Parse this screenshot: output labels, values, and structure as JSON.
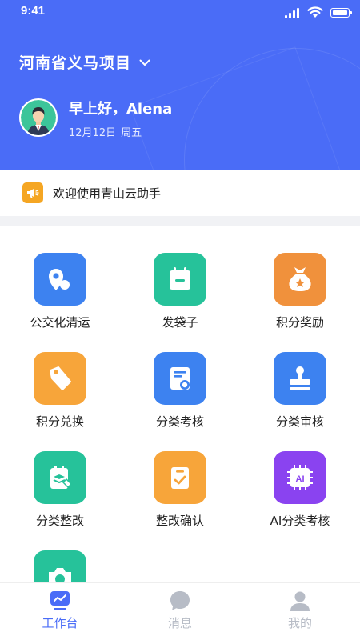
{
  "status_bar": {
    "time": "9:41"
  },
  "header": {
    "project_name": "河南省义马项目",
    "greeting": "早上好，Alena",
    "date": "12月12日",
    "weekday": "周五"
  },
  "notice": {
    "text": "欢迎使用青山云助手"
  },
  "colors": {
    "primary": "#4a6cf7",
    "tab_active": "#4a6cf7",
    "tab_inactive": "#b7bcc6"
  },
  "grid": {
    "items": [
      {
        "label": "公交化清运",
        "icon": "location-pin-icon",
        "color": "#3d82f0"
      },
      {
        "label": "发袋子",
        "icon": "bag-icon",
        "color": "#26c29a"
      },
      {
        "label": "积分奖励",
        "icon": "money-bag-icon",
        "color": "#f0913c"
      },
      {
        "label": "积分兑换",
        "icon": "tag-icon",
        "color": "#f7a53a"
      },
      {
        "label": "分类考核",
        "icon": "certificate-icon",
        "color": "#3d82f0"
      },
      {
        "label": "分类审核",
        "icon": "stamp-icon",
        "color": "#3d82f0"
      },
      {
        "label": "分类整改",
        "icon": "clipboard-edit-icon",
        "color": "#26c29a"
      },
      {
        "label": "整改确认",
        "icon": "clipboard-check-icon",
        "color": "#f7a53a"
      },
      {
        "label": "AI分类考核",
        "icon": "ai-chip-icon",
        "color": "#8a43f0"
      },
      {
        "label": "",
        "icon": "camera-icon",
        "color": "#26c29a"
      }
    ]
  },
  "tabbar": {
    "tabs": [
      {
        "label": "工作台",
        "icon": "workbench-icon",
        "active": true
      },
      {
        "label": "消息",
        "icon": "message-icon",
        "active": false
      },
      {
        "label": "我的",
        "icon": "profile-icon",
        "active": false
      }
    ]
  }
}
